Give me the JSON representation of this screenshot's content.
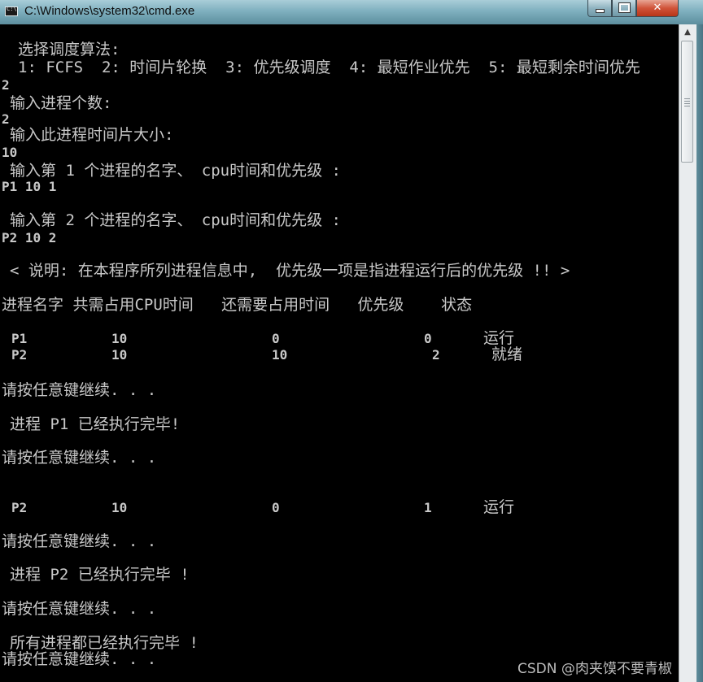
{
  "window": {
    "title": "C:\\Windows\\system32\\cmd.exe",
    "icon_text": "C:\\",
    "buttons": {
      "minimize": "minimize-icon",
      "maximize": "maximize-icon",
      "close": "✕"
    }
  },
  "console": {
    "lines": {
      "select_algo": "选择调度算法:",
      "algo_options": "1: FCFS  2: 时间片轮换  3: 优先级调度  4: 最短作业优先  5: 最短剩余时间优先",
      "input_1": "2",
      "prompt_count": "输入进程个数:",
      "input_2": "2",
      "prompt_slice": "输入此进程时间片大小:",
      "input_3": "10",
      "prompt_proc1": "输入第 1 个进程的名字、 cpu时间和优先级 :",
      "input_4": "P1 10 1",
      "prompt_proc2": "输入第 2 个进程的名字、 cpu时间和优先级 :",
      "input_5": "P2 10 2",
      "note": "< 说明: 在本程序所列进程信息中,  优先级一项是指进程运行后的优先级 !! >",
      "header": "进程名字 共需占用CPU时间   还需要占用时间   优先级    状态",
      "continue_1": "请按任意键继续. . .",
      "p1_done": "进程 P1 已经执行完毕!",
      "continue_2": "请按任意键继续. . .",
      "continue_3": "请按任意键继续. . .",
      "p2_done": "进程 P2 已经执行完毕 !",
      "continue_4": "请按任意键继续. . .",
      "all_done": "所有进程都已经执行完毕 !",
      "continue_5": "请按任意键继续. . ."
    },
    "table1": [
      {
        "name": "P1",
        "total": "10",
        "remain": "0",
        "priority": "0",
        "state": "运行"
      },
      {
        "name": "P2",
        "total": "10",
        "remain": "10",
        "priority": "2",
        "state": "就绪"
      }
    ],
    "table2": [
      {
        "name": "P2",
        "total": "10",
        "remain": "0",
        "priority": "1",
        "state": "运行"
      }
    ]
  },
  "scrollbar": {
    "up_arrow": "▲"
  },
  "watermark": "CSDN @肉夹馍不要青椒",
  "colors": {
    "console_bg": "#000000",
    "console_text": "#c8c8c8",
    "close_button": "#c7452a"
  }
}
